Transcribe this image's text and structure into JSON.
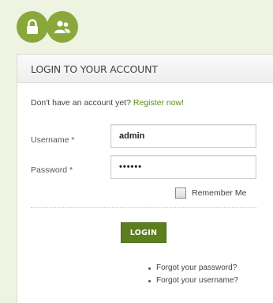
{
  "header_icons": [
    {
      "name": "lock-icon"
    },
    {
      "name": "users-icon"
    }
  ],
  "panel": {
    "title": "LOGIN TO YOUR ACCOUNT",
    "signup_prompt": "Don't have an account yet?",
    "signup_link": "Register now!"
  },
  "form": {
    "username_label": "Username *",
    "username_value": "admin",
    "password_label": "Password *",
    "password_value": "••••••",
    "remember_label": "Remember Me",
    "remember_checked": false,
    "login_button": "LOGIN"
  },
  "links": {
    "forgot_password": "Forgot your password?",
    "forgot_username": "Forgot your username?"
  },
  "colors": {
    "accent": "#8aa83a",
    "button": "#5a7f1c",
    "link": "#5e8a16",
    "background": "#eef3e2"
  }
}
